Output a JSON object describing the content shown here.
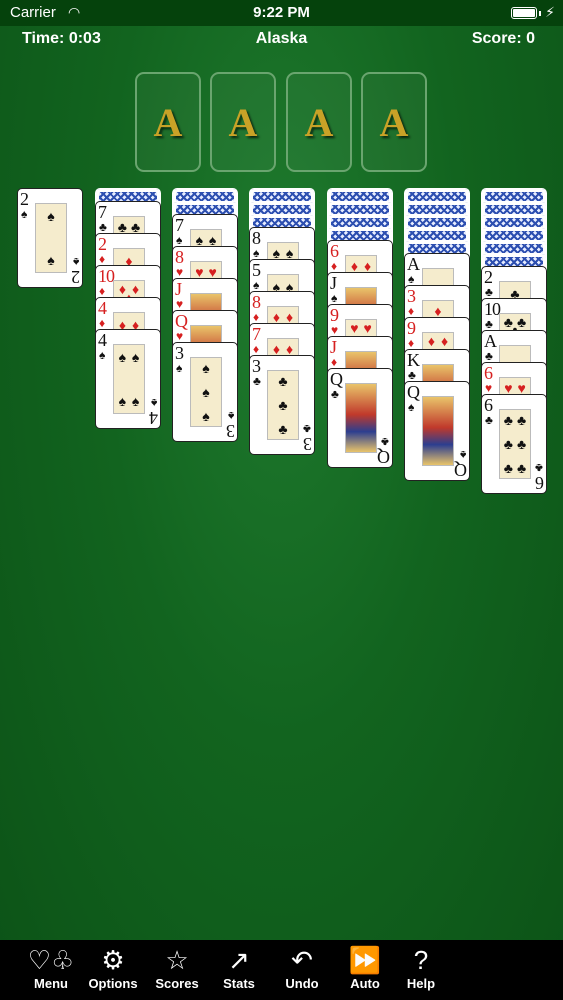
{
  "status_bar": {
    "carrier": "Carrier",
    "time": "9:22 PM"
  },
  "header": {
    "time": "Time: 0:03",
    "title": "Alaska",
    "score": "Score: 0"
  },
  "foundations": [
    "A",
    "A",
    "A",
    "A"
  ],
  "colors": {
    "felt": "#12641f",
    "foundation_border": "#6aa56f",
    "ace_gold": "#c9a227",
    "card_red": "#d62020"
  },
  "columns": [
    {
      "down": 0,
      "up": [
        {
          "rank": "2",
          "suit": "♠"
        }
      ]
    },
    {
      "down": 1,
      "up": [
        {
          "rank": "7",
          "suit": "♣"
        },
        {
          "rank": "2",
          "suit": "♦"
        },
        {
          "rank": "10",
          "suit": "♦"
        },
        {
          "rank": "4",
          "suit": "♦"
        },
        {
          "rank": "4",
          "suit": "♠"
        }
      ]
    },
    {
      "down": 2,
      "up": [
        {
          "rank": "7",
          "suit": "♠"
        },
        {
          "rank": "8",
          "suit": "♥"
        },
        {
          "rank": "J",
          "suit": "♥"
        },
        {
          "rank": "Q",
          "suit": "♥"
        },
        {
          "rank": "3",
          "suit": "♠"
        }
      ]
    },
    {
      "down": 3,
      "up": [
        {
          "rank": "8",
          "suit": "♠"
        },
        {
          "rank": "5",
          "suit": "♠"
        },
        {
          "rank": "8",
          "suit": "♦"
        },
        {
          "rank": "7",
          "suit": "♦"
        },
        {
          "rank": "3",
          "suit": "♣"
        }
      ]
    },
    {
      "down": 4,
      "up": [
        {
          "rank": "6",
          "suit": "♦"
        },
        {
          "rank": "J",
          "suit": "♠"
        },
        {
          "rank": "9",
          "suit": "♥"
        },
        {
          "rank": "J",
          "suit": "♦"
        },
        {
          "rank": "Q",
          "suit": "♣"
        }
      ]
    },
    {
      "down": 5,
      "up": [
        {
          "rank": "A",
          "suit": "♠"
        },
        {
          "rank": "3",
          "suit": "♦"
        },
        {
          "rank": "9",
          "suit": "♦"
        },
        {
          "rank": "K",
          "suit": "♣"
        },
        {
          "rank": "Q",
          "suit": "♠"
        }
      ]
    },
    {
      "down": 6,
      "up": [
        {
          "rank": "2",
          "suit": "♣"
        },
        {
          "rank": "10",
          "suit": "♣"
        },
        {
          "rank": "A",
          "suit": "♣"
        },
        {
          "rank": "6",
          "suit": "♥"
        },
        {
          "rank": "6",
          "suit": "♣"
        }
      ]
    }
  ],
  "toolbar": [
    {
      "label": "Menu",
      "icon": "menu-suits-icon",
      "glyph": "♡♧"
    },
    {
      "label": "Options",
      "icon": "gear-icon",
      "glyph": "⚙"
    },
    {
      "label": "Scores",
      "icon": "star-icon",
      "glyph": "☆"
    },
    {
      "label": "Stats",
      "icon": "chart-icon",
      "glyph": "↗"
    },
    {
      "label": "Undo",
      "icon": "undo-icon",
      "glyph": "↶"
    },
    {
      "label": "Auto",
      "icon": "fast-forward-icon",
      "glyph": "⏩"
    },
    {
      "label": "Help",
      "icon": "help-icon",
      "glyph": "?"
    }
  ]
}
